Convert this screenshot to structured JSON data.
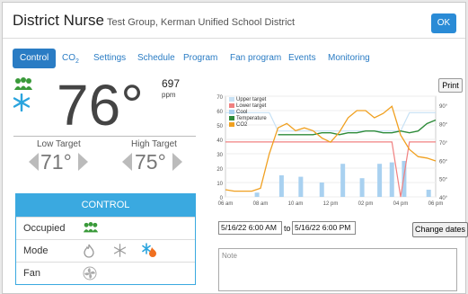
{
  "header": {
    "title": "District Nurse",
    "subtitle": "Test Group, Kerman Unified School District",
    "ok_label": "OK"
  },
  "tabs": [
    "Control",
    "CO",
    "Settings",
    "Schedule",
    "Program",
    "Fan program",
    "Events",
    "Monitoring"
  ],
  "tab_co2_sub": "2",
  "current": {
    "temperature": "76°",
    "co2": "697",
    "co2_unit": "ppm"
  },
  "targets": {
    "low_label": "Low Target",
    "low_value": "71°",
    "high_label": "High Target",
    "high_value": "75°"
  },
  "control": {
    "title": "CONTROL",
    "rows": [
      {
        "label": "Occupied",
        "icons": [
          "occupied-icon"
        ]
      },
      {
        "label": "Mode",
        "icons": [
          "heat-icon",
          "cool-icon",
          "auto-icon"
        ]
      },
      {
        "label": "Fan",
        "icons": [
          "fan-icon"
        ]
      }
    ]
  },
  "print_label": "Print",
  "date_from": "5/16/22 6:00 AM",
  "date_to_label": "to",
  "date_to": "5/16/22 6:00 PM",
  "change_dates_label": "Change dates",
  "note_placeholder": "Note",
  "colors": {
    "accent": "#3aa9e0",
    "upper": "#c7e1f5",
    "lower": "#f08080",
    "cool": "#a9d1f0",
    "temperature": "#2e8b3a",
    "co2": "#f0a020"
  },
  "chart_data": {
    "type": "line",
    "x_ticks": [
      "06 am",
      "08 am",
      "10 am",
      "12 pm",
      "02 pm",
      "04 pm",
      "06 pm"
    ],
    "y_left_ticks": [
      "0",
      "10",
      "20",
      "30",
      "40",
      "50",
      "60",
      "70"
    ],
    "y_right_ticks": [
      "40°",
      "50°",
      "60°",
      "70°",
      "80°",
      "90°"
    ],
    "ylim_left": [
      0,
      70
    ],
    "ylim_right": [
      40,
      95
    ],
    "legend": [
      "Upper target",
      "Lower target",
      "Cool",
      "Temperature",
      "CO2"
    ],
    "legend_position": "top-left",
    "hours": [
      6,
      6.5,
      7,
      7.5,
      8,
      8.5,
      9,
      9.5,
      10,
      10.5,
      11,
      11.5,
      12,
      12.5,
      13,
      13.5,
      14,
      14.5,
      15,
      15.5,
      16,
      16.5,
      17,
      17.5,
      18
    ],
    "temperature_f": [
      null,
      null,
      null,
      null,
      null,
      null,
      74,
      74,
      74,
      74,
      74,
      75,
      75,
      74,
      75,
      75,
      76,
      76,
      75,
      75,
      76,
      75,
      76,
      80,
      82
    ],
    "co2_ppm": [
      5,
      4,
      4,
      4,
      6,
      30,
      48,
      51,
      46,
      48,
      46,
      41,
      38,
      45,
      55,
      60,
      60,
      55,
      58,
      63,
      43,
      33,
      28,
      27,
      25
    ],
    "upper_target_f": [
      86,
      86,
      86,
      86,
      86,
      86,
      76,
      76,
      76,
      76,
      76,
      76,
      76,
      76,
      76,
      76,
      76,
      76,
      76,
      76,
      76,
      86,
      86,
      86,
      86
    ],
    "lower_target_f": [
      70,
      70,
      70,
      70,
      70,
      70,
      70,
      70,
      70,
      70,
      70,
      70,
      70,
      70,
      70,
      70,
      70,
      70,
      70,
      70,
      40,
      70,
      70,
      70,
      70
    ],
    "cool_bars": [
      {
        "hour": 7.8,
        "value": 3
      },
      {
        "hour": 9.2,
        "value": 15
      },
      {
        "hour": 10.3,
        "value": 14
      },
      {
        "hour": 11.5,
        "value": 10
      },
      {
        "hour": 12.7,
        "value": 23
      },
      {
        "hour": 13.8,
        "value": 13
      },
      {
        "hour": 14.8,
        "value": 23
      },
      {
        "hour": 15.5,
        "value": 24
      },
      {
        "hour": 16.2,
        "value": 25
      },
      {
        "hour": 17.6,
        "value": 5
      }
    ]
  }
}
